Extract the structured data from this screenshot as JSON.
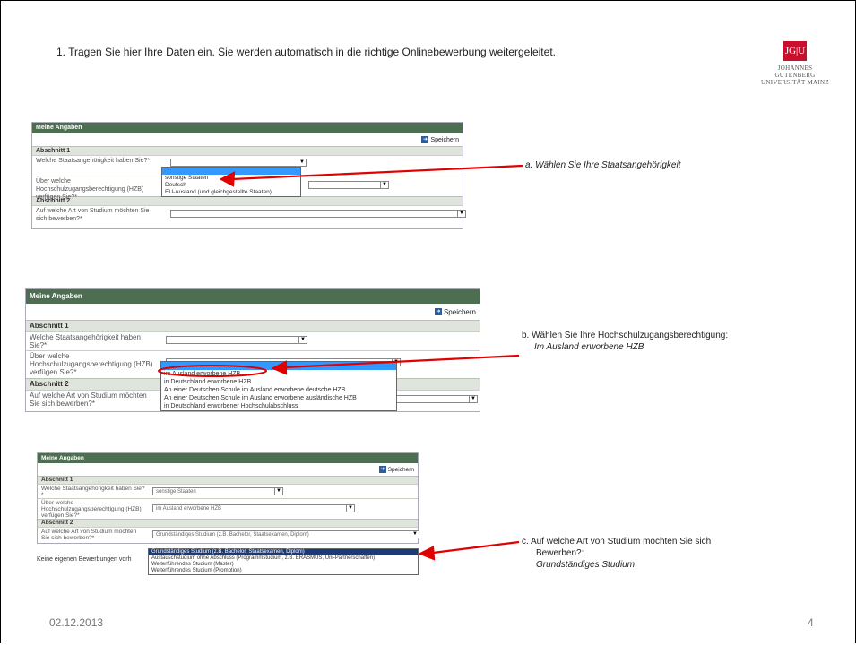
{
  "instruction": "1.   Tragen Sie hier Ihre Daten ein. Sie werden automatisch in die richtige Onlinebewerbung weitergeleitet.",
  "logo": {
    "box": "JG|U",
    "line1": "JOHANNES GUTENBERG",
    "line2": "UNIVERSITÄT MAINZ"
  },
  "form": {
    "header": "Meine Angaben",
    "save": "Speichern",
    "section1": "Abschnitt 1",
    "q_nationality": "Welche Staatsangehörigkeit haben Sie?*",
    "q_hzb": "Über welche Hochschulzugangsberechtigung (HZB) verfügen Sie?*",
    "section2": "Abschnitt 2",
    "q_study": "Auf welche Art von Studium möchten Sie sich bewerben?*"
  },
  "step_a": {
    "options": [
      "",
      "sonstige Staaten",
      "Deutsch",
      "EU-Ausland (und gleichgestellte Staaten)"
    ],
    "annotation": "a.    Wählen Sie Ihre Staatsangehörigkeit"
  },
  "step_b": {
    "options": [
      "",
      "im Ausland erworbene HZB",
      "in Deutschland erworbene HZB",
      "An einer Deutschen Schule im Ausland erworbene deutsche HZB",
      "An einer Deutschen Schule im Ausland erworbene ausländische HZB",
      "in Deutschland erworbener Hochschulabschluss"
    ],
    "annotation_line1": "b. Wählen Sie Ihre Hochschulzugangsberechtigung:",
    "annotation_line2": "Im Ausland erworbene HZB"
  },
  "step_c": {
    "nationality_value": "sonstige Staaten",
    "hzb_value": "im Ausland erworbene HZB",
    "study_value": "Grundständiges Studium (z.B. Bachelor, Staatsexamen, Diplom)",
    "options": [
      "Grundständiges Studium (z.B. Bachelor, Staatsexamen, Diplom)",
      "Austauschstudium ohne Abschluss (Programmstudium, z.B. ERASMUS, Uni-Partnerschaften)",
      "Weiterführendes Studium (Master)",
      "Weiterführendes Studium (Promotion)"
    ],
    "no_applications": "Keine eigenen Bewerbungen vorh",
    "annotation_line1": "c.  Auf welche Art von Studium möchten Sie sich",
    "annotation_line2": "Bewerben?:",
    "annotation_line3": "Grundständiges Studium"
  },
  "footer": {
    "date": "02.12.2013",
    "page": "4"
  },
  "colors": {
    "arrow": "#e00000",
    "header": "#4e6e52",
    "highlight": "#3399ff"
  }
}
